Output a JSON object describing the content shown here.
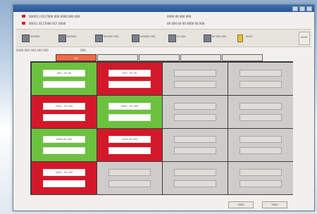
{
  "window": {
    "title": ""
  },
  "info_rows": [
    {
      "left": "000011 0117000 000 0000 000 000",
      "right": "0000  00 000 000",
      "color": "#d3182a"
    },
    {
      "left": "00011 0117000 017 0000",
      "right": "00 000  00 00 0000 00 000",
      "color": "#d3182a"
    }
  ],
  "toolbar": {
    "items": [
      {
        "label": "000000",
        "icon": "monitor-icon"
      },
      {
        "label": "000000",
        "icon": "calendar-icon"
      },
      {
        "label": "000000 000",
        "icon": "grid-icon"
      },
      {
        "label": "000000 000",
        "icon": "report-icon"
      },
      {
        "label": "00 000",
        "icon": "list-icon"
      },
      {
        "label": "00 000 000",
        "icon": "settings-icon"
      },
      {
        "label": "0000",
        "icon": "warning-icon"
      }
    ],
    "end_button_label": "0000"
  },
  "section": {
    "label_left": "0000 000 000 000 000",
    "label_right": "000"
  },
  "tabs": [
    {
      "label": "000",
      "active": true
    },
    {
      "label": "",
      "active": false
    },
    {
      "label": "",
      "active": false
    },
    {
      "label": "",
      "active": false
    },
    {
      "label": "",
      "active": false
    }
  ],
  "grid": {
    "rows": [
      [
        {
          "status": "green",
          "line1": "000 - 00 00",
          "line2": ""
        },
        {
          "status": "red",
          "line1": "000 - 00 00",
          "line2": ""
        },
        {
          "status": "empty",
          "line1": "",
          "line2": ""
        },
        {
          "status": "empty",
          "line1": "",
          "line2": ""
        }
      ],
      [
        {
          "status": "red",
          "line1": "0000 - 00 000",
          "line2": ""
        },
        {
          "status": "green",
          "line1": "0000 - 00 000",
          "line2": ""
        },
        {
          "status": "empty",
          "line1": "",
          "line2": ""
        },
        {
          "status": "empty",
          "line1": "",
          "line2": ""
        }
      ],
      [
        {
          "status": "green",
          "line1": "0000 00 000",
          "line2": ""
        },
        {
          "status": "red",
          "line1": "0000 00 000",
          "line2": ""
        },
        {
          "status": "empty",
          "line1": "",
          "line2": ""
        },
        {
          "status": "empty",
          "line1": "",
          "line2": ""
        }
      ],
      [
        {
          "status": "red",
          "line1": "0000 - 00 000",
          "line2": ""
        },
        {
          "status": "empty",
          "line1": "",
          "line2": ""
        },
        {
          "status": "empty",
          "line1": "",
          "line2": ""
        },
        {
          "status": "empty",
          "line1": "",
          "line2": ""
        }
      ]
    ]
  },
  "footer": {
    "ok_label": "0000",
    "cancel_label": "0000"
  },
  "colors": {
    "green": "#6cc13f",
    "red": "#d3182a",
    "empty": "#cfcdca",
    "tab_active": "#ef6a49"
  }
}
